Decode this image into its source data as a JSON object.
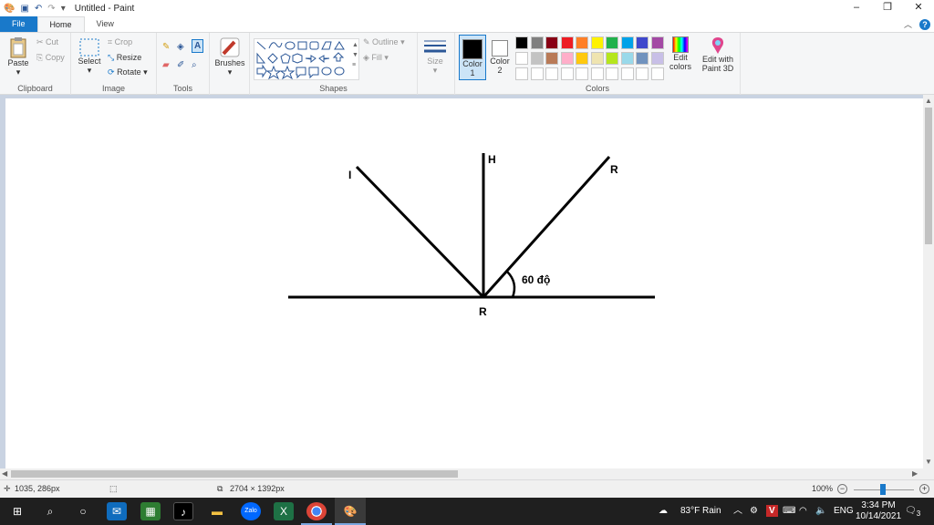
{
  "window": {
    "title": "Untitled - Paint"
  },
  "tabs": [
    {
      "label": "File"
    },
    {
      "label": "Home"
    },
    {
      "label": "View"
    }
  ],
  "clipboard": {
    "paste": "Paste",
    "cut": "Cut",
    "copy": "Copy",
    "group": "Clipboard"
  },
  "image": {
    "select": "Select",
    "crop": "Crop",
    "resize": "Resize",
    "rotate": "Rotate",
    "group": "Image"
  },
  "tools": {
    "group": "Tools"
  },
  "brushes": {
    "label": "Brushes"
  },
  "shapes": {
    "outline": "Outline",
    "fill": "Fill",
    "group": "Shapes"
  },
  "size": {
    "label": "Size"
  },
  "colors": {
    "color1": "Color",
    "color1_num": "1",
    "color2": "Color",
    "color2_num": "2",
    "edit": "Edit",
    "edit2": "colors",
    "paint3d": "Edit with",
    "paint3d2": "Paint 3D",
    "group": "Colors",
    "palette_row1": [
      "#000000",
      "#7f7f7f",
      "#880015",
      "#ed1c24",
      "#ff7f27",
      "#fff200",
      "#22b14c",
      "#00a2e8",
      "#3f48cc",
      "#a349a4"
    ],
    "palette_row2": [
      "#ffffff",
      "#c3c3c3",
      "#b97a57",
      "#ffaec9",
      "#ffc90e",
      "#efe4b0",
      "#b5e61d",
      "#99d9ea",
      "#7092be",
      "#c8bfe7"
    ]
  },
  "drawing": {
    "label_incident": "I",
    "label_normal": "H",
    "label_reflected": "R",
    "label_point": "R",
    "label_angle": "60 độ"
  },
  "status": {
    "cursor_pos": "1035, 286px",
    "canvas_size": "2704 × 1392px",
    "zoom": "100%"
  },
  "taskbar": {
    "weather": "83°F  Rain",
    "lang": "ENG",
    "time": "3:34 PM",
    "date": "10/14/2021",
    "notif_count": "3"
  }
}
